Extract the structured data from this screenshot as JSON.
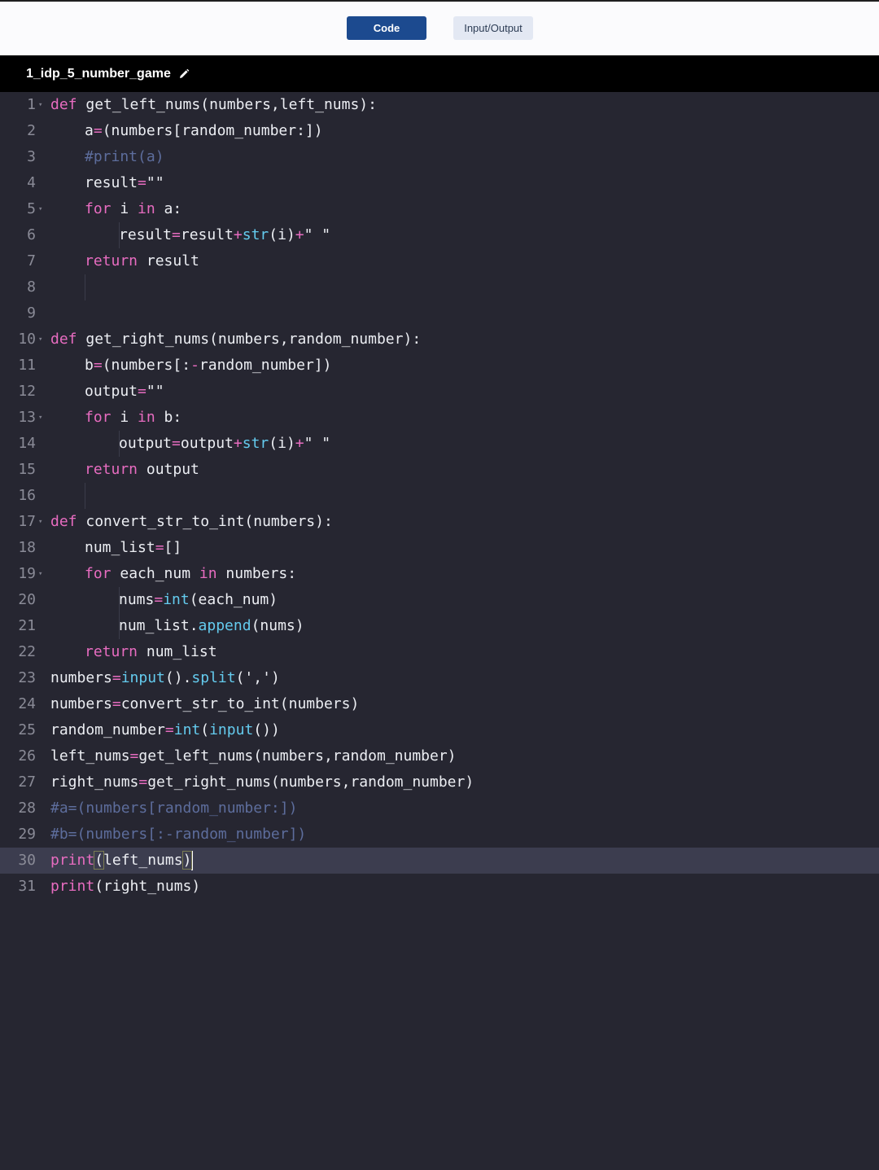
{
  "tabs": {
    "code_label": "Code",
    "io_label": "Input/Output"
  },
  "file": {
    "name": "1_idp_5_number_game"
  },
  "editor": {
    "active_line": 30,
    "lines": [
      {
        "n": "1",
        "fold": true,
        "indent": 0,
        "tokens": [
          [
            "kw",
            "def"
          ],
          [
            "t",
            " get_left_nums(numbers,left_nums):"
          ]
        ]
      },
      {
        "n": "2",
        "indent": 1,
        "tokens": [
          [
            "t",
            "a"
          ],
          [
            "op",
            "="
          ],
          [
            "t",
            "(numbers[random_number:])"
          ]
        ]
      },
      {
        "n": "3",
        "indent": 1,
        "tokens": [
          [
            "cm",
            "#print(a)"
          ]
        ]
      },
      {
        "n": "4",
        "indent": 1,
        "tokens": [
          [
            "t",
            "result"
          ],
          [
            "op",
            "="
          ],
          [
            "t",
            "\"\""
          ]
        ]
      },
      {
        "n": "5",
        "fold": true,
        "indent": 1,
        "tokens": [
          [
            "kw",
            "for"
          ],
          [
            "t",
            " i "
          ],
          [
            "kw",
            "in"
          ],
          [
            "t",
            " a:"
          ]
        ]
      },
      {
        "n": "6",
        "indent": 2,
        "tokens": [
          [
            "t",
            "result"
          ],
          [
            "op",
            "="
          ],
          [
            "t",
            "result"
          ],
          [
            "op",
            "+"
          ],
          [
            "fn",
            "str"
          ],
          [
            "t",
            "(i)"
          ],
          [
            "op",
            "+"
          ],
          [
            "t",
            "\" \""
          ]
        ]
      },
      {
        "n": "7",
        "indent": 1,
        "tokens": [
          [
            "kw",
            "return"
          ],
          [
            "t",
            " result"
          ]
        ]
      },
      {
        "n": "8",
        "indent": 1,
        "tokens": []
      },
      {
        "n": "9",
        "indent": 0,
        "tokens": []
      },
      {
        "n": "10",
        "fold": true,
        "indent": 0,
        "tokens": [
          [
            "kw",
            "def"
          ],
          [
            "t",
            " get_right_nums(numbers,random_number):"
          ]
        ]
      },
      {
        "n": "11",
        "indent": 1,
        "tokens": [
          [
            "t",
            "b"
          ],
          [
            "op",
            "="
          ],
          [
            "t",
            "(numbers[:"
          ],
          [
            "op",
            "-"
          ],
          [
            "t",
            "random_number])"
          ]
        ]
      },
      {
        "n": "12",
        "indent": 1,
        "tokens": [
          [
            "t",
            "output"
          ],
          [
            "op",
            "="
          ],
          [
            "t",
            "\"\""
          ]
        ]
      },
      {
        "n": "13",
        "fold": true,
        "indent": 1,
        "tokens": [
          [
            "kw",
            "for"
          ],
          [
            "t",
            " i "
          ],
          [
            "kw",
            "in"
          ],
          [
            "t",
            " b:"
          ]
        ]
      },
      {
        "n": "14",
        "indent": 2,
        "tokens": [
          [
            "t",
            "output"
          ],
          [
            "op",
            "="
          ],
          [
            "t",
            "output"
          ],
          [
            "op",
            "+"
          ],
          [
            "fn",
            "str"
          ],
          [
            "t",
            "(i)"
          ],
          [
            "op",
            "+"
          ],
          [
            "t",
            "\" \""
          ]
        ]
      },
      {
        "n": "15",
        "indent": 1,
        "tokens": [
          [
            "kw",
            "return"
          ],
          [
            "t",
            " output"
          ]
        ]
      },
      {
        "n": "16",
        "indent": 1,
        "tokens": []
      },
      {
        "n": "17",
        "fold": true,
        "indent": 0,
        "tokens": [
          [
            "kw",
            "def"
          ],
          [
            "t",
            " convert_str_to_int(numbers):"
          ]
        ]
      },
      {
        "n": "18",
        "indent": 1,
        "tokens": [
          [
            "t",
            "num_list"
          ],
          [
            "op",
            "="
          ],
          [
            "t",
            "[]"
          ]
        ]
      },
      {
        "n": "19",
        "fold": true,
        "indent": 1,
        "tokens": [
          [
            "kw",
            "for"
          ],
          [
            "t",
            " each_num "
          ],
          [
            "kw",
            "in"
          ],
          [
            "t",
            " numbers:"
          ]
        ]
      },
      {
        "n": "20",
        "indent": 2,
        "tokens": [
          [
            "t",
            "nums"
          ],
          [
            "op",
            "="
          ],
          [
            "fn",
            "int"
          ],
          [
            "t",
            "(each_num)"
          ]
        ]
      },
      {
        "n": "21",
        "indent": 2,
        "tokens": [
          [
            "t",
            "num_list."
          ],
          [
            "fn",
            "append"
          ],
          [
            "t",
            "(nums)"
          ]
        ]
      },
      {
        "n": "22",
        "indent": 1,
        "tokens": [
          [
            "kw",
            "return"
          ],
          [
            "t",
            " num_list"
          ]
        ]
      },
      {
        "n": "23",
        "indent": 0,
        "tokens": [
          [
            "t",
            "numbers"
          ],
          [
            "op",
            "="
          ],
          [
            "fn",
            "input"
          ],
          [
            "t",
            "()."
          ],
          [
            "fn",
            "split"
          ],
          [
            "t",
            "(',')"
          ]
        ]
      },
      {
        "n": "24",
        "indent": 0,
        "tokens": [
          [
            "t",
            "numbers"
          ],
          [
            "op",
            "="
          ],
          [
            "t",
            "convert_str_to_int(numbers)"
          ]
        ]
      },
      {
        "n": "25",
        "indent": 0,
        "tokens": [
          [
            "t",
            "random_number"
          ],
          [
            "op",
            "="
          ],
          [
            "fn",
            "int"
          ],
          [
            "t",
            "("
          ],
          [
            "fn",
            "input"
          ],
          [
            "t",
            "())"
          ]
        ]
      },
      {
        "n": "26",
        "indent": 0,
        "tokens": [
          [
            "t",
            "left_nums"
          ],
          [
            "op",
            "="
          ],
          [
            "t",
            "get_left_nums(numbers,random_number)"
          ]
        ]
      },
      {
        "n": "27",
        "indent": 0,
        "tokens": [
          [
            "t",
            "right_nums"
          ],
          [
            "op",
            "="
          ],
          [
            "t",
            "get_right_nums(numbers,random_number)"
          ]
        ]
      },
      {
        "n": "28",
        "indent": 0,
        "tokens": [
          [
            "cm",
            "#a=(numbers[random_number:])"
          ]
        ]
      },
      {
        "n": "29",
        "indent": 0,
        "tokens": [
          [
            "cm",
            "#b=(numbers[:-random_number])"
          ]
        ]
      },
      {
        "n": "30",
        "indent": 0,
        "tokens": [
          [
            "kw",
            "print"
          ],
          [
            "hl",
            "("
          ],
          [
            "t",
            "left_nums"
          ],
          [
            "hl",
            ")"
          ]
        ]
      },
      {
        "n": "31",
        "indent": 0,
        "tokens": [
          [
            "kw",
            "print"
          ],
          [
            "t",
            "(right_nums)"
          ]
        ]
      }
    ]
  },
  "colors": {
    "keyword": "#e76cc0",
    "function": "#64cbee",
    "comment": "#5d6d9c",
    "text": "#eceef3",
    "background": "#262631"
  }
}
